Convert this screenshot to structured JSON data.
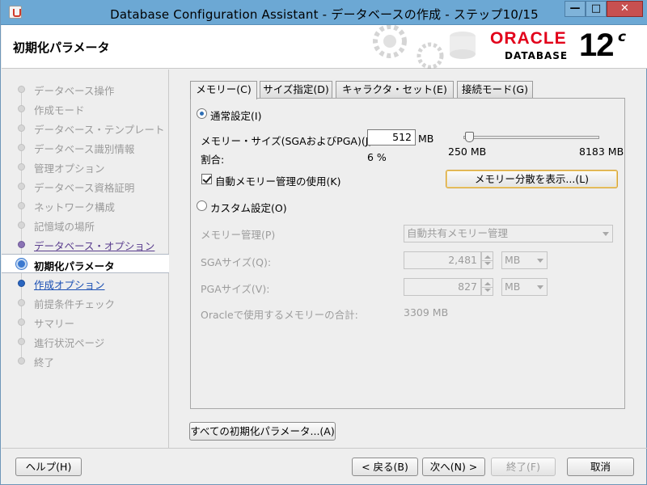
{
  "window": {
    "title": "Database Configuration Assistant - データベースの作成 - ステップ10/15",
    "min_glyph": "—",
    "max_glyph": "□",
    "close_glyph": "✕"
  },
  "header": {
    "page_title": "初期化パラメータ",
    "brand": "ORACLE",
    "brand_sub": "DATABASE",
    "version": "12",
    "version_sup": "c",
    "brand_color": "#e2001a"
  },
  "nav": {
    "items": [
      {
        "label": "データベース操作",
        "state": "pending"
      },
      {
        "label": "作成モード",
        "state": "pending"
      },
      {
        "label": "データベース・テンプレート",
        "state": "pending"
      },
      {
        "label": "データベース識別情報",
        "state": "pending"
      },
      {
        "label": "管理オプション",
        "state": "pending"
      },
      {
        "label": "データベース資格証明",
        "state": "pending"
      },
      {
        "label": "ネットワーク構成",
        "state": "pending"
      },
      {
        "label": "記憶域の場所",
        "state": "pending"
      },
      {
        "label": "データベース・オプション",
        "state": "visited"
      },
      {
        "label": "初期化パラメータ",
        "state": "current"
      },
      {
        "label": "作成オプション",
        "state": "next"
      },
      {
        "label": "前提条件チェック",
        "state": "pending"
      },
      {
        "label": "サマリー",
        "state": "pending"
      },
      {
        "label": "進行状況ページ",
        "state": "pending"
      },
      {
        "label": "終了",
        "state": "pending"
      }
    ]
  },
  "tabs": [
    {
      "label": "メモリー(C)",
      "active": true
    },
    {
      "label": "サイズ指定(D)",
      "active": false
    },
    {
      "label": "キャラクタ・セット(E)",
      "active": false
    },
    {
      "label": "接続モード(G)",
      "active": false
    }
  ],
  "memory": {
    "typical_label": "通常設定(I)",
    "typical_selected": true,
    "size_label": "メモリー・サイズ(SGAおよびPGA)(J):",
    "size_value": "512",
    "size_unit": "MB",
    "slider_min_label": "250 MB",
    "slider_max_label": "8183 MB",
    "slider_fraction": 0.033,
    "percent_label": "割合:",
    "percent_value": "6 %",
    "auto_mem_label": "自動メモリー管理の使用(K)",
    "auto_mem_checked": true,
    "show_distribution_button": "メモリー分散を表示...(L)",
    "custom_label": "カスタム設定(O)",
    "custom_selected": false,
    "mem_mgmt_label": "メモリー管理(P)",
    "mem_mgmt_value": "自動共有メモリー管理",
    "sga_label": "SGAサイズ(Q):",
    "sga_value": "2,481",
    "sga_unit": "MB",
    "pga_label": "PGAサイズ(V):",
    "pga_value": "827",
    "pga_unit": "MB",
    "total_label": "Oracleで使用するメモリーの合計:",
    "total_value": "3309 MB"
  },
  "all_params_button": "すべての初期化パラメータ...(A)",
  "footer": {
    "help": "ヘルプ(H)",
    "back": "< 戻る(B)",
    "next": "次へ(N) >",
    "finish": "終了(F)",
    "cancel": "取消"
  }
}
